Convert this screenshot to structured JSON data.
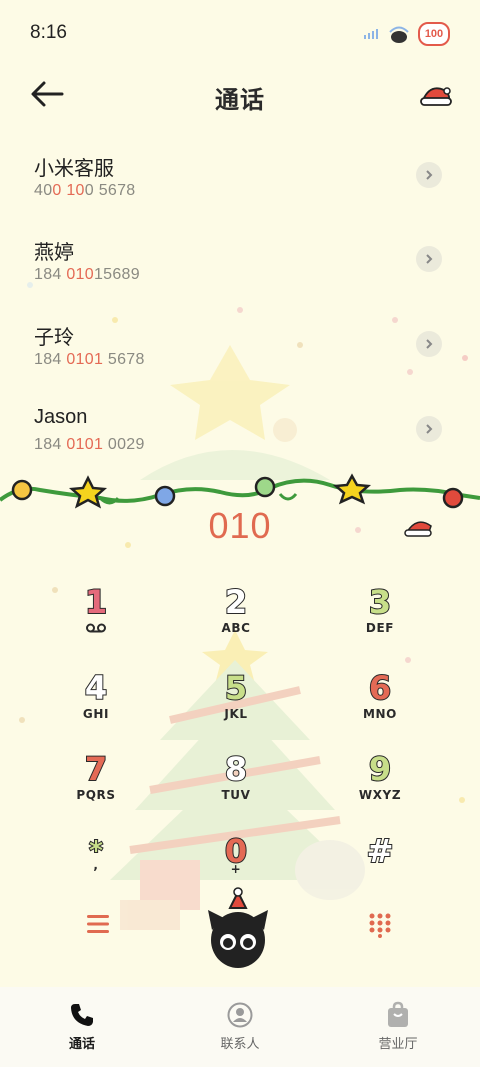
{
  "status_bar": {
    "time": "8:16",
    "battery": "100"
  },
  "header": {
    "title": "通话"
  },
  "contacts": [
    {
      "name": "小米客服",
      "num_pre": "40",
      "num_hl": "0 10",
      "num_post": "0 5678"
    },
    {
      "name": "燕婷",
      "num_pre": "184 ",
      "num_hl": "010",
      "num_post": "15689"
    },
    {
      "name": "子玲",
      "num_pre": "184 ",
      "num_hl": "0101",
      "num_post": " 5678"
    },
    {
      "name": "Jason",
      "num_pre": "184 ",
      "num_hl": "0101",
      "num_post": " 0029"
    }
  ],
  "dialed_number": "010",
  "keypad": [
    {
      "digit": "1",
      "letters": "",
      "color": "#e46a7b",
      "icon": "voicemail-icon"
    },
    {
      "digit": "2",
      "letters": "ABC",
      "color": "#ffffff"
    },
    {
      "digit": "3",
      "letters": "DEF",
      "color": "#c8df8a"
    },
    {
      "digit": "4",
      "letters": "GHI",
      "color": "#ffffff"
    },
    {
      "digit": "5",
      "letters": "JKL",
      "color": "#c8df8a"
    },
    {
      "digit": "6",
      "letters": "MNO",
      "color": "#e46a55"
    },
    {
      "digit": "7",
      "letters": "PQRS",
      "color": "#e46a55"
    },
    {
      "digit": "8",
      "letters": "TUV",
      "color": "#ffffff"
    },
    {
      "digit": "9",
      "letters": "WXYZ",
      "color": "#c8df8a"
    },
    {
      "digit": "*",
      "letters": ",",
      "color": "#c8df8a"
    },
    {
      "digit": "0",
      "letters": "+",
      "color": "#e46a55"
    },
    {
      "digit": "#",
      "letters": "",
      "color": "#ffffff"
    }
  ],
  "bottom_nav": [
    {
      "label": "通话",
      "icon": "phone-icon",
      "active": true
    },
    {
      "label": "联系人",
      "icon": "contacts-icon",
      "active": false
    },
    {
      "label": "营业厅",
      "icon": "shop-bag-icon",
      "active": false
    }
  ],
  "colors": {
    "accent": "#e06a50",
    "background": "#fdfbe6",
    "garland": "#3e9a3c"
  }
}
